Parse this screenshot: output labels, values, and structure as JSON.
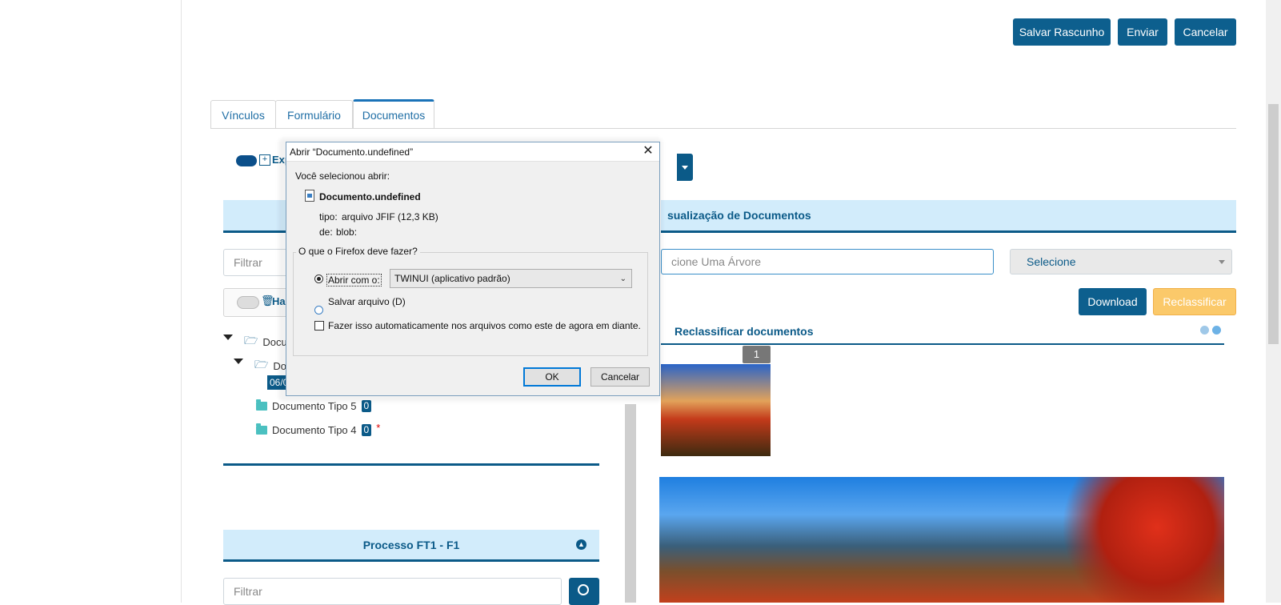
{
  "header": {
    "save_draft": "Salvar Rascunho",
    "send": "Enviar",
    "cancel": "Cancelar"
  },
  "tabs": [
    {
      "label": "Vínculos"
    },
    {
      "label": "Formulário"
    },
    {
      "label": "Documentos"
    }
  ],
  "left_panel": {
    "toggle_label": "Exp",
    "filter_placeholder": "Filtrar",
    "toggle2_label": "Hab",
    "tree": [
      {
        "label": "Docum"
      },
      {
        "label": "Doc"
      },
      {
        "label": "06/0"
      },
      {
        "label": "Documento Tipo 5",
        "count": "0"
      },
      {
        "label": "Documento Tipo 4",
        "count": "0",
        "required": "*"
      }
    ],
    "process_title": "Processo FT1 - F1",
    "process_filter_placeholder": "Filtrar"
  },
  "right_panel": {
    "title": "sualização de Documentos",
    "tree_placeholder": "cione Uma Árvore",
    "select_label": "Selecione",
    "download": "Download",
    "reclassify": "Reclassificar",
    "reclassify_link": "Reclassificar documentos",
    "thumb_number": "1"
  },
  "dialog": {
    "title": "Abrir “Documento.undefined”",
    "selected_text": "Você selecionou abrir:",
    "filename": "Documento.undefined",
    "type_label": "tipo:",
    "type_value": "arquivo JFIF (12,3 KB)",
    "from_label": "de:",
    "from_value": "blob:",
    "question": "O que o Firefox deve fazer?",
    "open_with": "Abrir com o:",
    "app": "TWINUI (aplicativo padrão)",
    "save_file": "Salvar arquivo (D)",
    "auto": "Fazer isso automaticamente nos arquivos como este de agora em diante.",
    "ok": "OK",
    "cancel": "Cancelar"
  },
  "colors": {
    "primary": "#0d5f8e",
    "warning": "#fbc96a",
    "panel_head_bg": "#d2ecfb"
  }
}
